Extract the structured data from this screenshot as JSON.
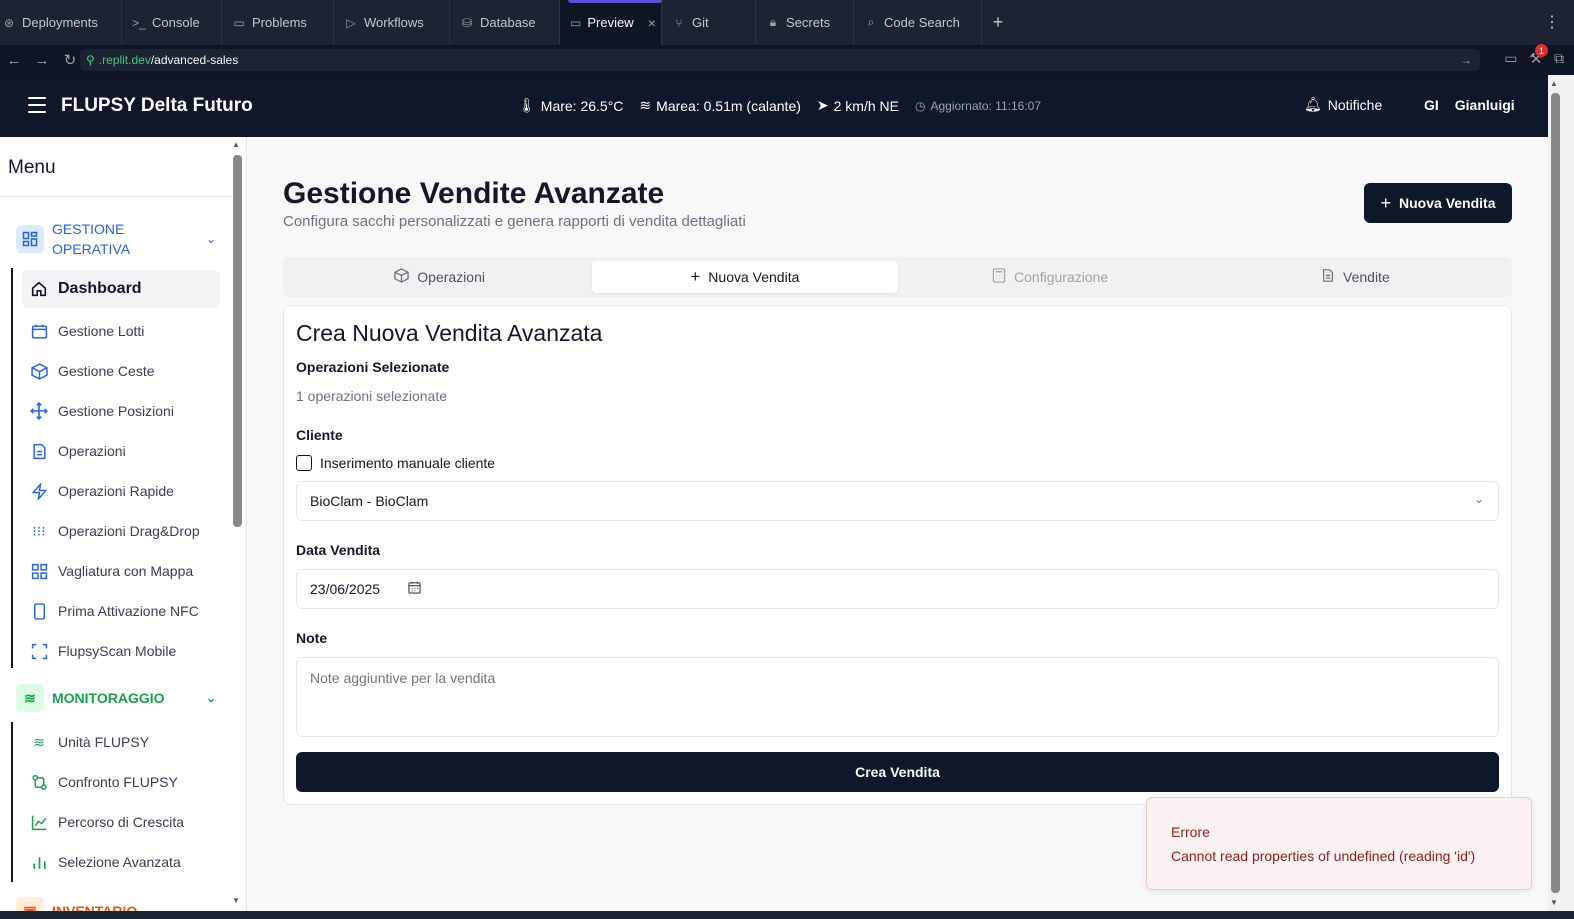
{
  "replit": {
    "tabs": [
      {
        "label": "Deployments",
        "icon": "deploy-icon"
      },
      {
        "label": "Console",
        "icon": "terminal-icon"
      },
      {
        "label": "Problems",
        "icon": "problems-icon"
      },
      {
        "label": "Workflows",
        "icon": "play-icon"
      },
      {
        "label": "Database",
        "icon": "database-icon"
      },
      {
        "label": "Preview",
        "icon": "monitor-icon",
        "active": true
      },
      {
        "label": "Git",
        "icon": "git-icon"
      },
      {
        "label": "Secrets",
        "icon": "lock-icon"
      },
      {
        "label": "Code Search",
        "icon": "search-icon"
      }
    ],
    "url_domain": ".replit.dev",
    "url_path": "/advanced-sales",
    "badge_count": "1"
  },
  "header": {
    "title": "FLUPSY Delta Futuro",
    "sea_temp": "Mare: 26.5°C",
    "tide": "Marea: 0.51m (calante)",
    "wind": "2 km/h NE",
    "updated": "Aggiornato: 11:16:07",
    "notifications": "Notifiche",
    "user_initials": "GI",
    "user_name": "Gianluigi"
  },
  "sidebar": {
    "title": "Menu",
    "section_operativa_line1": "GESTIONE",
    "section_operativa_line2": "OPERATIVA",
    "operativa_items": [
      "Dashboard",
      "Gestione Lotti",
      "Gestione Ceste",
      "Gestione Posizioni",
      "Operazioni",
      "Operazioni Rapide",
      "Operazioni Drag&Drop",
      "Vagliatura con Mappa",
      "Prima Attivazione NFC",
      "FlupsyScan Mobile"
    ],
    "section_monitoraggio": "MONITORAGGIO",
    "monitoraggio_items": [
      "Unità FLUPSY",
      "Confronto FLUPSY",
      "Percorso di Crescita",
      "Selezione Avanzata"
    ],
    "section_inventario": "INVENTARIO"
  },
  "page": {
    "title": "Gestione Vendite Avanzate",
    "subtitle": "Configura sacchi personalizzati e genera rapporti di vendita dettagliati",
    "new_sale_button": "Nuova Vendita",
    "tabs": [
      "Operazioni",
      "Nuova Vendita",
      "Configurazione",
      "Vendite"
    ]
  },
  "form": {
    "title": "Crea Nuova Vendita Avanzata",
    "selected_ops_label": "Operazioni Selezionate",
    "selected_ops_value": "1 operazioni selezionate",
    "client_label": "Cliente",
    "manual_client_label": "Inserimento manuale cliente",
    "client_value": "BioClam - BioClam",
    "date_label": "Data Vendita",
    "date_value": "23/06/2025",
    "notes_label": "Note",
    "notes_placeholder": "Note aggiuntive per la vendita",
    "submit": "Crea Vendita"
  },
  "toast": {
    "title": "Errore",
    "message": "Cannot read properties of undefined (reading 'id')"
  },
  "colors": {
    "brand_dark": "#0f172a",
    "accent_blue": "#2563eb",
    "accent_green": "#16a34a",
    "error_red": "#991b1b"
  }
}
